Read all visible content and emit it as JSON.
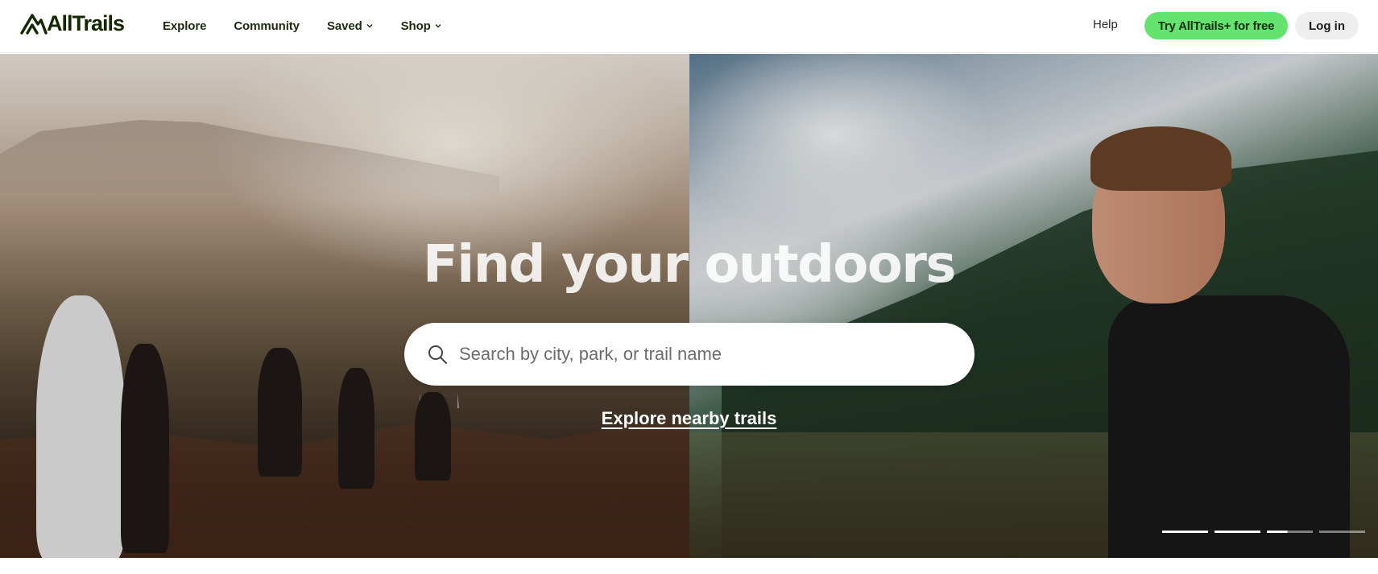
{
  "brand": {
    "name": "AllTrails"
  },
  "nav": {
    "links": [
      {
        "label": "Explore",
        "has_dropdown": false
      },
      {
        "label": "Community",
        "has_dropdown": false
      },
      {
        "label": "Saved",
        "has_dropdown": true
      },
      {
        "label": "Shop",
        "has_dropdown": true
      }
    ],
    "help": "Help",
    "try_button": "Try AllTrails+ for free",
    "login_button": "Log in"
  },
  "hero": {
    "title": "Find your outdoors",
    "search_placeholder": "Search by city, park, or trail name",
    "explore_link": "Explore nearby trails",
    "carousel_progress": [
      1,
      1,
      0.45,
      0
    ]
  },
  "colors": {
    "accent": "#64e36e",
    "brand_dark": "#142800"
  },
  "icons": {
    "logo": "mountain-logo-icon",
    "dropdown": "chevron-down-icon",
    "search": "search-icon"
  }
}
